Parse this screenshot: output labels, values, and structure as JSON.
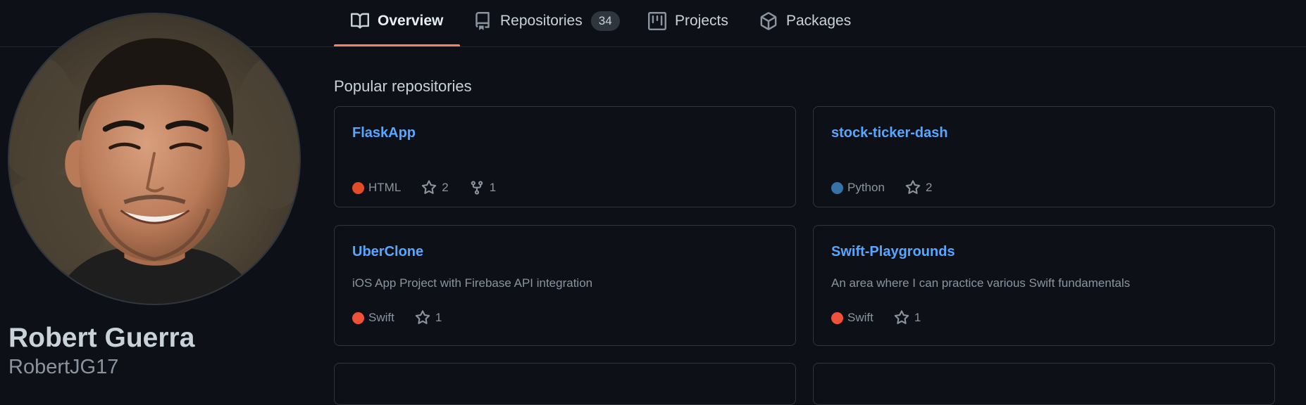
{
  "tabs": [
    {
      "label": "Overview",
      "icon": "book-icon"
    },
    {
      "label": "Repositories",
      "icon": "repo-icon",
      "count": "34"
    },
    {
      "label": "Projects",
      "icon": "project-icon"
    },
    {
      "label": "Packages",
      "icon": "package-icon"
    }
  ],
  "profile": {
    "full_name": "Robert Guerra",
    "username": "RobertJG17",
    "avatar": "profile-photo"
  },
  "popular": {
    "title": "Popular repositories",
    "repos": [
      {
        "name": "FlaskApp",
        "description": "",
        "language": "HTML",
        "lang_color": "#e34c26",
        "stars": "2",
        "forks": "1"
      },
      {
        "name": "stock-ticker-dash",
        "description": "",
        "language": "Python",
        "lang_color": "#3572A5",
        "stars": "2"
      },
      {
        "name": "UberClone",
        "description": "iOS App Project with Firebase API integration",
        "language": "Swift",
        "lang_color": "#F05138",
        "stars": "1"
      },
      {
        "name": "Swift-Playgrounds",
        "description": "An area where I can practice various Swift fundamentals",
        "language": "Swift",
        "lang_color": "#F05138",
        "stars": "1"
      }
    ]
  },
  "colors": {
    "background": "#0d1117",
    "border": "#30363d",
    "link": "#58a6ff",
    "muted": "#8b949e",
    "active_tab_underline": "#f78166"
  }
}
